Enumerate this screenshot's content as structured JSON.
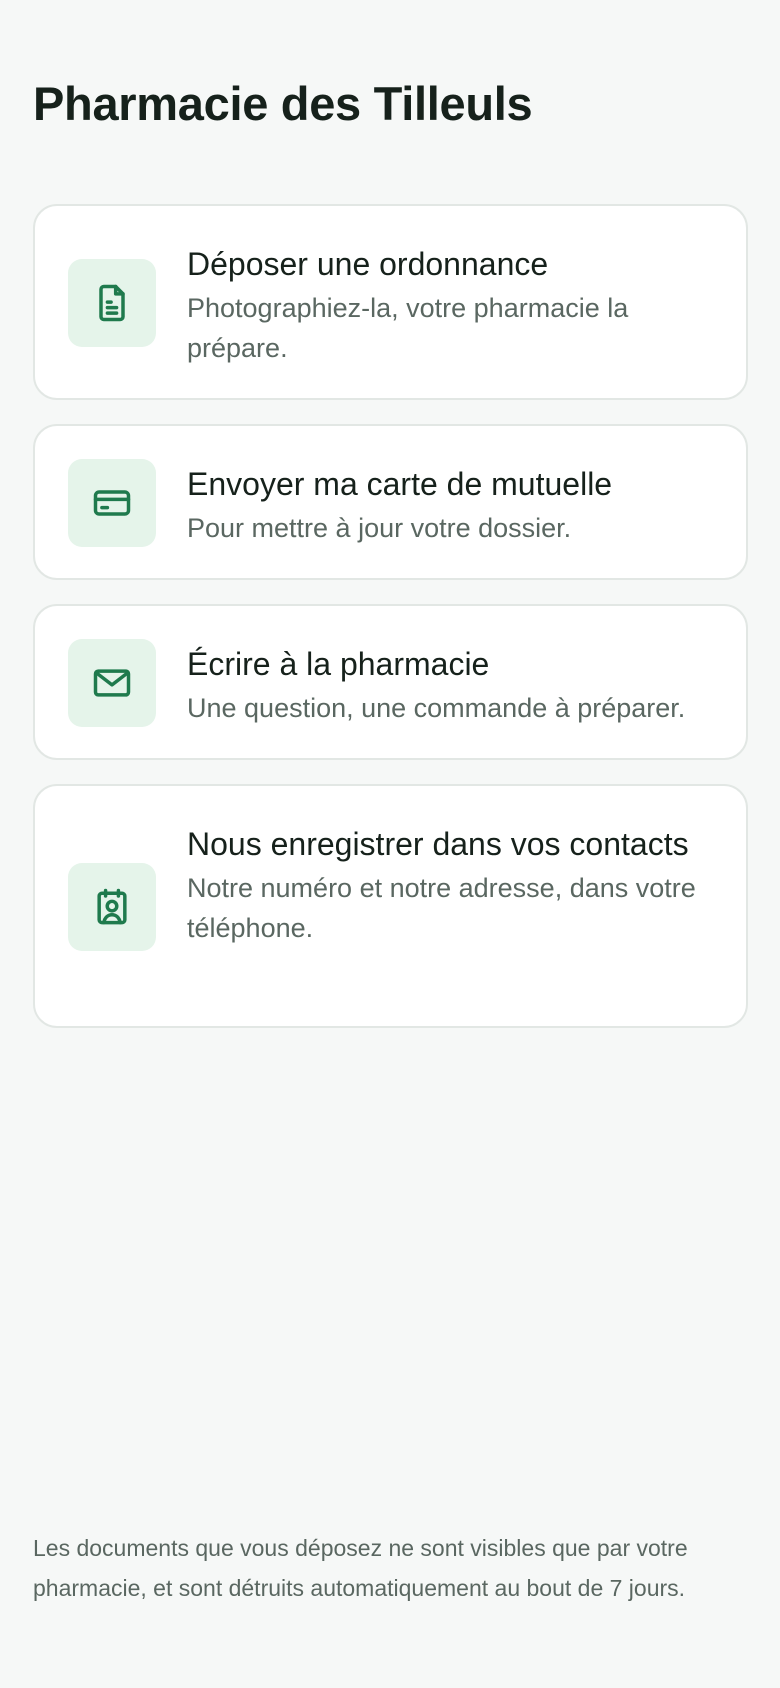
{
  "header": {
    "title": "Pharmacie des Tilleuls"
  },
  "actions": [
    {
      "icon": "document-icon",
      "title": "Déposer une ordonnance",
      "description": "Photographiez-la, votre pharmacie la prépare."
    },
    {
      "icon": "credit-card-icon",
      "title": "Envoyer ma carte de mutuelle",
      "description": "Pour mettre à jour votre dossier."
    },
    {
      "icon": "mail-icon",
      "title": "Écrire à la pharmacie",
      "description": "Une question, une commande à préparer."
    },
    {
      "icon": "contact-card-icon",
      "title": "Nous enregistrer dans vos contacts",
      "description": "Notre numéro et notre adresse, dans votre téléphone."
    }
  ],
  "footer": {
    "note": "Les documents que vous déposez ne sont visibles que par votre pharmacie, et sont détruits automatiquement au bout de 7 jours."
  },
  "colors": {
    "background": "#f6f8f7",
    "accent": "#1f7a4d",
    "icon_bg": "#e5f4ea",
    "card_border": "#e2e7e4",
    "muted_text": "#5a6761"
  }
}
